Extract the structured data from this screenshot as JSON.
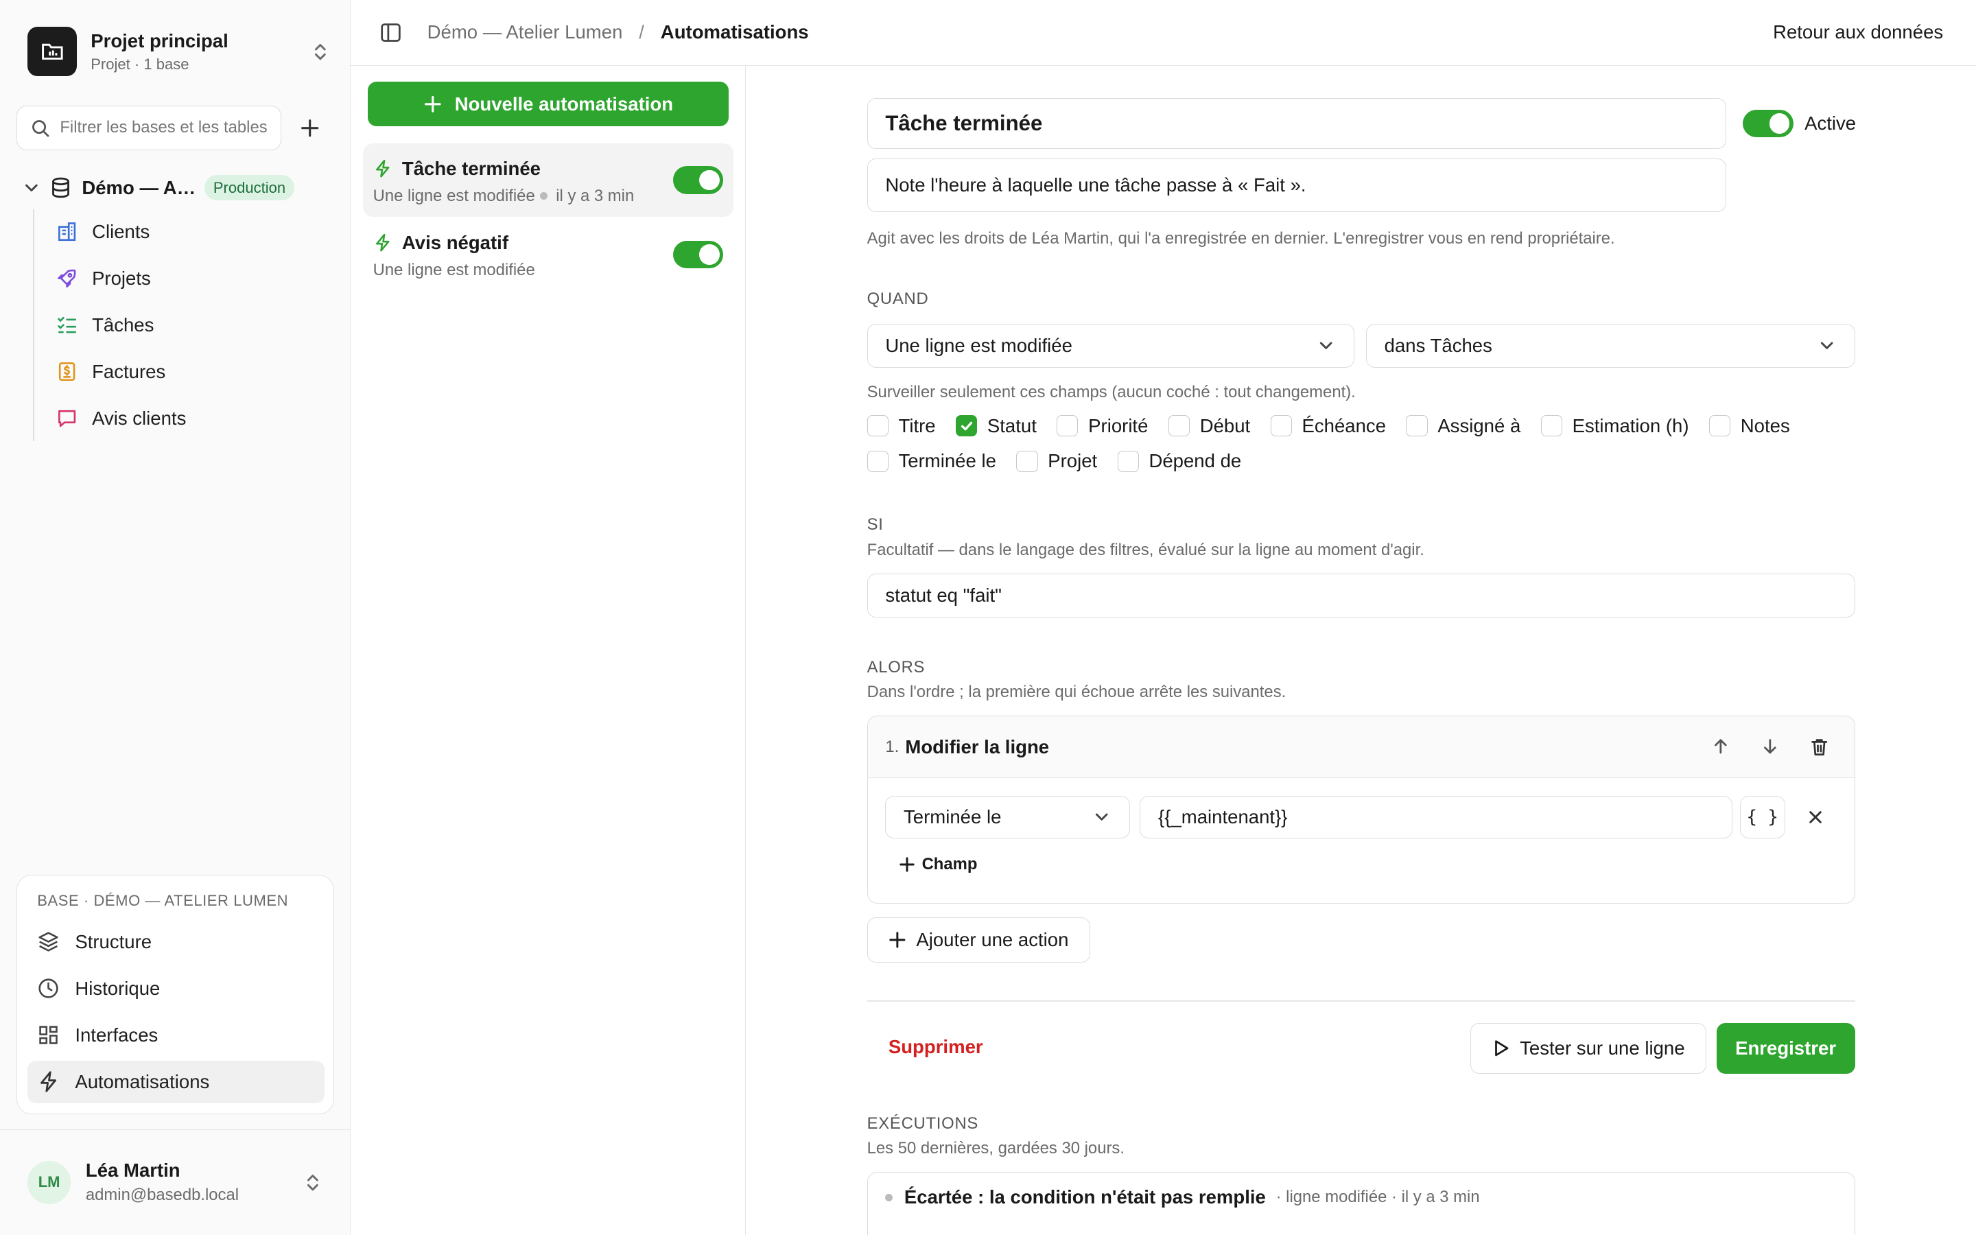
{
  "sidebar": {
    "project_name": "Projet principal",
    "project_sub": "Projet · 1 base",
    "filter_placeholder": "Filtrer les bases et les tables",
    "db_name": "Démo — A…",
    "db_badge": "Production",
    "tables": [
      {
        "label": "Clients",
        "icon": "building-icon",
        "color": "#3b6fd8"
      },
      {
        "label": "Projets",
        "icon": "rocket-icon",
        "color": "#7c4ddb"
      },
      {
        "label": "Tâches",
        "icon": "task-list-icon",
        "color": "#2a9d5c"
      },
      {
        "label": "Factures",
        "icon": "invoice-icon",
        "color": "#e0951c"
      },
      {
        "label": "Avis clients",
        "icon": "message-icon",
        "color": "#d6336c"
      }
    ],
    "base_section_title": "BASE · DÉMO — ATELIER LUMEN",
    "base_items": [
      {
        "label": "Structure",
        "icon": "layers-icon"
      },
      {
        "label": "Historique",
        "icon": "clock-icon"
      },
      {
        "label": "Interfaces",
        "icon": "grid-icon"
      },
      {
        "label": "Automatisations",
        "icon": "bolt-icon"
      }
    ],
    "user": {
      "initials": "LM",
      "name": "Léa Martin",
      "email": "admin@basedb.local"
    }
  },
  "topbar": {
    "crumb_parent": "Démo — Atelier Lumen",
    "crumb_sep": "/",
    "crumb_current": "Automatisations",
    "back_link": "Retour aux données"
  },
  "automations": {
    "new_button": "Nouvelle automatisation",
    "items": [
      {
        "title": "Tâche terminée",
        "trigger": "Une ligne est modifiée",
        "time": "il y a 3 min",
        "enabled": true
      },
      {
        "title": "Avis négatif",
        "trigger": "Une ligne est modifiée",
        "time": "",
        "enabled": true
      }
    ]
  },
  "editor": {
    "name": "Tâche terminée",
    "description": "Note l'heure à laquelle une tâche passe à « Fait ».",
    "active_label": "Active",
    "ownership_note": "Agit avec les droits de Léa Martin, qui l'a enregistrée en dernier. L'enregistrer vous en rend propriétaire.",
    "when": {
      "label": "QUAND",
      "trigger": "Une ligne est modifiée",
      "table": "dans Tâches",
      "fields_note": "Surveiller seulement ces champs (aucun coché : tout changement).",
      "fields_row1": [
        {
          "label": "Titre",
          "checked": false
        },
        {
          "label": "Statut",
          "checked": true
        },
        {
          "label": "Priorité",
          "checked": false
        },
        {
          "label": "Début",
          "checked": false
        },
        {
          "label": "Échéance",
          "checked": false
        },
        {
          "label": "Assigné à",
          "checked": false
        },
        {
          "label": "Estimation (h)",
          "checked": false
        },
        {
          "label": "Notes",
          "checked": false
        }
      ],
      "fields_row2": [
        {
          "label": "Terminée le",
          "checked": false
        },
        {
          "label": "Projet",
          "checked": false
        },
        {
          "label": "Dépend de",
          "checked": false
        }
      ]
    },
    "if": {
      "label": "SI",
      "note": "Facultatif — dans le langage des filtres, évalué sur la ligne au moment d'agir.",
      "condition": "statut eq \"fait\""
    },
    "then": {
      "label": "ALORS",
      "note": "Dans l'ordre ; la première qui échoue arrête les suivantes.",
      "action_number": "1.",
      "action_title": "Modifier la ligne",
      "field_name": "Terminée le",
      "field_value": "{{_maintenant}}",
      "braces_label": "{ }",
      "add_field": "Champ",
      "add_action": "Ajouter une action"
    },
    "delete_label": "Supprimer",
    "test_label": "Tester sur une ligne",
    "save_label": "Enregistrer",
    "executions": {
      "label": "EXÉCUTIONS",
      "note": "Les 50 dernières, gardées 30 jours.",
      "first_status": "Écartée : la condition n'était pas remplie",
      "first_meta": "· ligne modifiée · il y a 3 min"
    }
  },
  "colors": {
    "accent": "#2ea52e",
    "danger": "#d42020"
  }
}
